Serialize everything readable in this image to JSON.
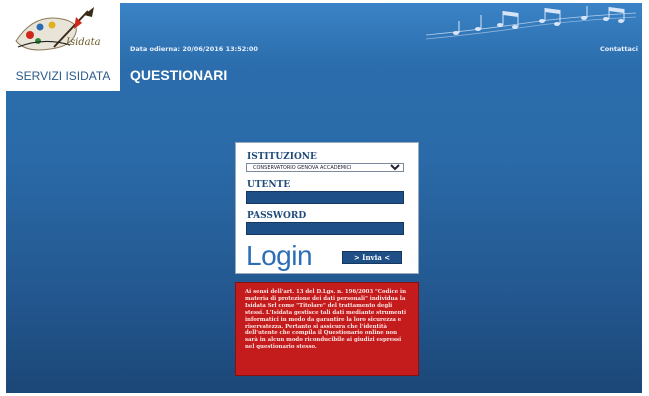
{
  "header": {
    "logo_text": "Isidata",
    "date_line": "Data odierna: 20/06/2016 13:52:00",
    "contact_link": "Contattaci"
  },
  "sidebar": {
    "services_label": "SERVIZI ISIDATA"
  },
  "main": {
    "section_title": "QUESTIONARI"
  },
  "login_form": {
    "institution_label": "ISTITUZIONE",
    "institution_selected": "CONSERVATORIO GENOVA ACCADEMICI",
    "user_label": "UTENTE",
    "user_value": "",
    "password_label": "PASSWORD",
    "password_value": "",
    "login_heading": "Login",
    "submit_label": "> Invia <"
  },
  "privacy_notice": {
    "text": "Ai sensi dell'art. 13 del D.Lgs. n. 196/2003 \"Codice in materia di protezione dei dati personali\" individua la Isidata Srl come \"Titolare\" del trattamento degli stessi. L'Isidata gestisce tali dati mediante strumenti informatici in modo da garantire la loro sicurezza e riservatezza. Pertanto si assicura che l'identità dell'utente che compila il Questionario online non sarà in alcun modo riconducibile ai giudizi espressi nel questionario stesso."
  },
  "colors": {
    "background_blue": "#2a6aa8",
    "field_blue": "#1e4f86",
    "notice_red": "#c41c1c",
    "logo_red": "#d1271b"
  },
  "icons": {
    "logo": "isidata-palette-logo",
    "decoration": "music-notes-decoration"
  }
}
